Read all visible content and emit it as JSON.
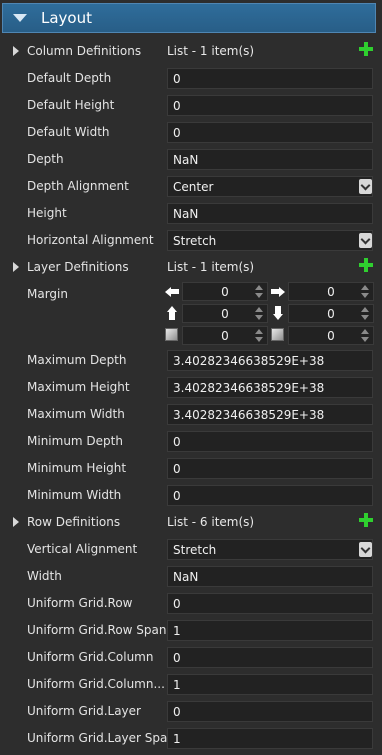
{
  "section": {
    "title": "Layout"
  },
  "rows": {
    "column_definitions": {
      "label": "Column Definitions",
      "value": "List - 1 item(s)"
    },
    "default_depth": {
      "label": "Default Depth",
      "value": "0"
    },
    "default_height": {
      "label": "Default Height",
      "value": "0"
    },
    "default_width": {
      "label": "Default Width",
      "value": "0"
    },
    "depth": {
      "label": "Depth",
      "value": "NaN"
    },
    "depth_alignment": {
      "label": "Depth Alignment",
      "value": "Center"
    },
    "height": {
      "label": "Height",
      "value": "NaN"
    },
    "horizontal_alignment": {
      "label": "Horizontal Alignment",
      "value": "Stretch"
    },
    "layer_definitions": {
      "label": "Layer Definitions",
      "value": "List - 1 item(s)"
    },
    "margin": {
      "label": "Margin",
      "left": "0",
      "right": "0",
      "top": "0",
      "bottom": "0",
      "front": "0",
      "back": "0"
    },
    "maximum_depth": {
      "label": "Maximum Depth",
      "value": "3.40282346638529E+38"
    },
    "maximum_height": {
      "label": "Maximum Height",
      "value": "3.40282346638529E+38"
    },
    "maximum_width": {
      "label": "Maximum Width",
      "value": "3.40282346638529E+38"
    },
    "minimum_depth": {
      "label": "Minimum Depth",
      "value": "0"
    },
    "minimum_height": {
      "label": "Minimum Height",
      "value": "0"
    },
    "minimum_width": {
      "label": "Minimum Width",
      "value": "0"
    },
    "row_definitions": {
      "label": "Row Definitions",
      "value": "List - 6 item(s)"
    },
    "vertical_alignment": {
      "label": "Vertical Alignment",
      "value": "Stretch"
    },
    "width": {
      "label": "Width",
      "value": "NaN"
    },
    "ug_row": {
      "label": "Uniform Grid.Row",
      "value": "0"
    },
    "ug_row_span": {
      "label": "Uniform Grid.Row Span",
      "value": "1"
    },
    "ug_column": {
      "label": "Uniform Grid.Column",
      "value": "0"
    },
    "ug_column_span": {
      "label": "Uniform Grid.Column...",
      "value": "1"
    },
    "ug_layer": {
      "label": "Uniform Grid.Layer",
      "value": "0"
    },
    "ug_layer_span": {
      "label": "Uniform Grid.Layer Span",
      "value": "1"
    }
  },
  "icons": {
    "header": "collapse-triangle-icon",
    "expander": "expand-triangle-icon",
    "add": "add-plus-icon",
    "dropdown": "chevron-down-icon"
  },
  "colors": {
    "accent": "#2f6d9b",
    "add": "#2fcf2f"
  }
}
